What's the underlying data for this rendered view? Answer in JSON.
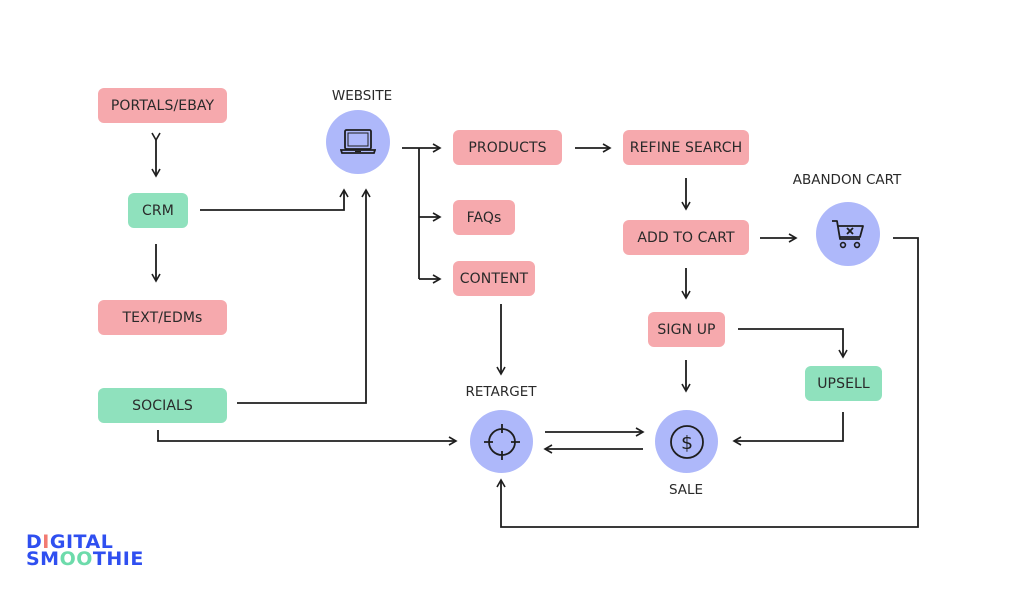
{
  "colors": {
    "source_node": "#f6a9ad",
    "channel_node": "#8fe1bd",
    "stage_circle": "#aeb8fa",
    "line": "#1e1e1e",
    "logo_blue": "#2f4ff0",
    "logo_pink": "#f27b72",
    "logo_green": "#6ddbab"
  },
  "nodes": {
    "portals_ebay": "PORTALS/EBAY",
    "crm": "CRM",
    "text_edms": "TEXT/EDMs",
    "socials": "SOCIALS",
    "products": "PRODUCTS",
    "faqs": "FAQs",
    "content": "CONTENT",
    "refine_search": "REFINE SEARCH",
    "add_to_cart": "ADD TO CART",
    "sign_up": "SIGN UP",
    "upsell": "UPSELL"
  },
  "stages": {
    "website": {
      "label": "WEBSITE",
      "icon": "laptop-icon"
    },
    "abandon_cart": {
      "label": "ABANDON CART",
      "icon": "cart-x-icon"
    },
    "retarget": {
      "label": "RETARGET",
      "icon": "crosshair-icon"
    },
    "sale": {
      "label": "SALE",
      "icon": "dollar-icon"
    }
  },
  "edges": [
    [
      "portals_ebay",
      "crm",
      "bidirectional"
    ],
    [
      "crm",
      "text_edms"
    ],
    [
      "crm",
      "website"
    ],
    [
      "socials",
      "website"
    ],
    [
      "socials",
      "retarget"
    ],
    [
      "website",
      "products"
    ],
    [
      "website",
      "faqs"
    ],
    [
      "website",
      "content"
    ],
    [
      "products",
      "refine_search"
    ],
    [
      "refine_search",
      "add_to_cart"
    ],
    [
      "add_to_cart",
      "abandon_cart"
    ],
    [
      "add_to_cart",
      "sign_up"
    ],
    [
      "sign_up",
      "sale"
    ],
    [
      "sign_up",
      "upsell"
    ],
    [
      "upsell",
      "sale"
    ],
    [
      "content",
      "retarget"
    ],
    [
      "retarget",
      "sale"
    ],
    [
      "sale",
      "retarget"
    ],
    [
      "abandon_cart",
      "retarget"
    ]
  ],
  "logo": {
    "line1_a": "D",
    "line1_b": "I",
    "line1_c": "GITAL",
    "line2_a": "SM",
    "line2_b": "OO",
    "line2_c": "THIE"
  }
}
